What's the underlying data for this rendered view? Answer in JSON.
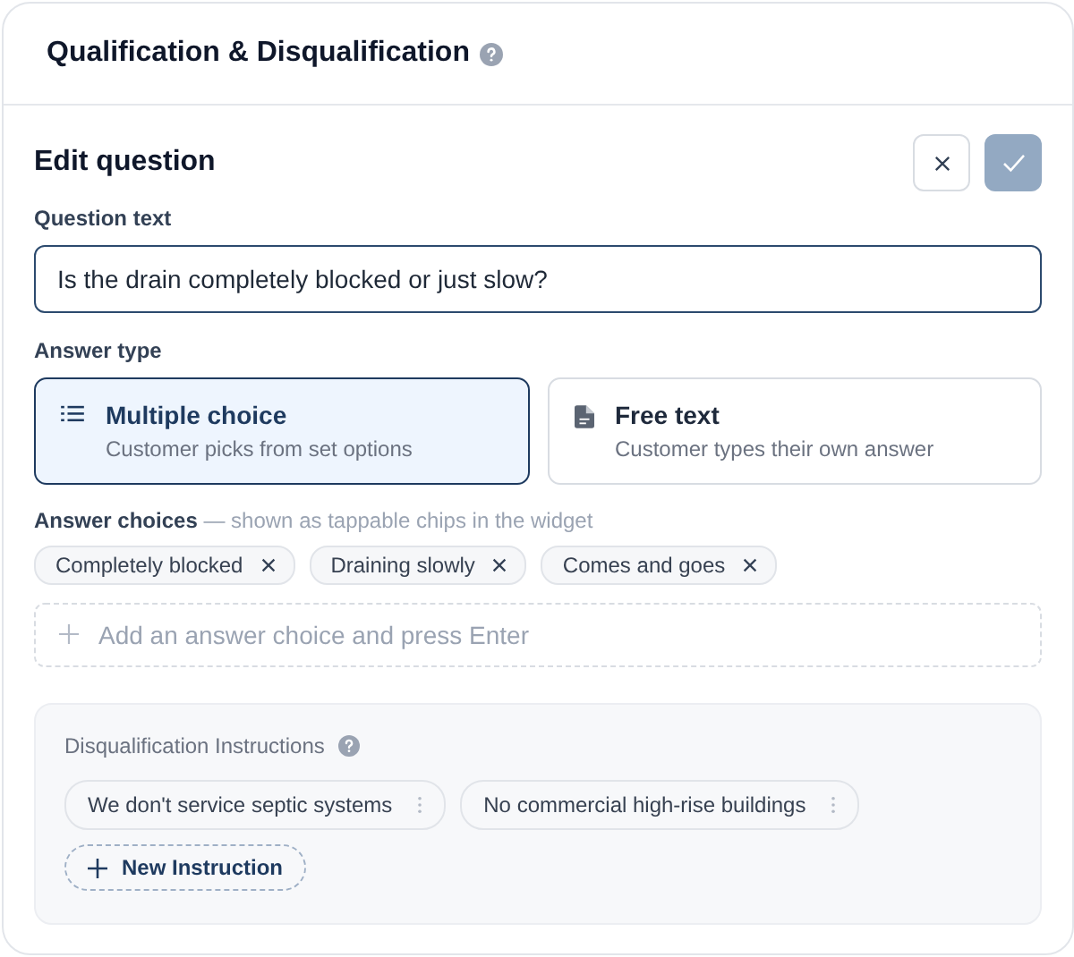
{
  "header": {
    "title": "Qualification & Disqualification"
  },
  "editor": {
    "title": "Edit question",
    "question_label": "Question text",
    "question_value": "Is the drain completely blocked or just slow?",
    "answer_type_label": "Answer type",
    "answer_types": [
      {
        "kind": "list",
        "title": "Multiple choice",
        "description": "Customer picks from set options",
        "selected": true
      },
      {
        "kind": "document",
        "title": "Free text",
        "description": "Customer types their own answer",
        "selected": false
      }
    ],
    "choices_label": "**Answer choices** — shown as tappable chips in the widget",
    "choices": [
      "Completely blocked",
      "Draining slowly",
      "Comes and goes"
    ],
    "add_choice": {
      "placeholder": "Add an answer choice and press Enter"
    }
  },
  "disqualification": {
    "title": "Disqualification Instructions",
    "instructions": [
      "We don't service septic systems",
      "No commercial high-rise buildings"
    ],
    "new_button": "New Instruction"
  }
}
